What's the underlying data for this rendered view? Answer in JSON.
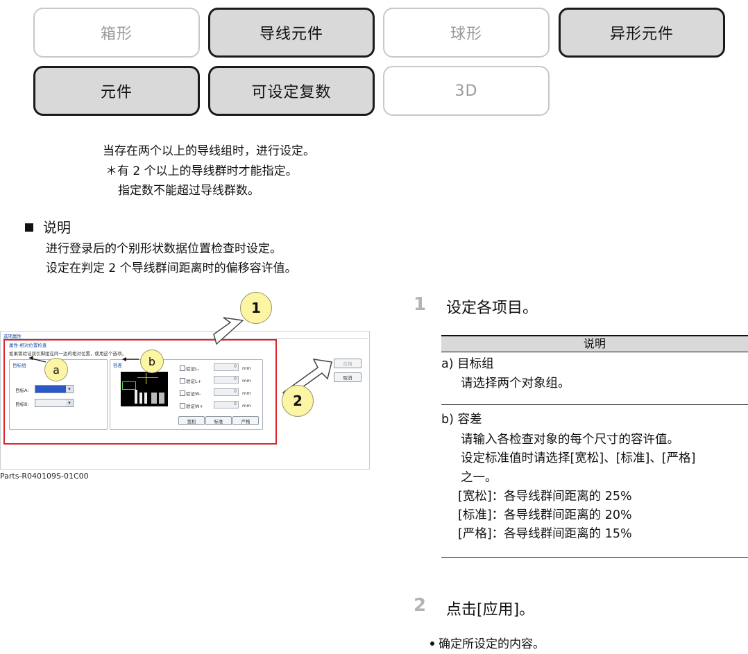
{
  "categories": [
    {
      "label": "箱形",
      "state": "off"
    },
    {
      "label": "导线元件",
      "state": "on"
    },
    {
      "label": "球形",
      "state": "off"
    },
    {
      "label": "异形元件",
      "state": "on"
    },
    {
      "label": "元件",
      "state": "on"
    },
    {
      "label": "可设定复数",
      "state": "on"
    },
    {
      "label": "3D",
      "state": "off"
    }
  ],
  "notes": {
    "line1": "当存在两个以上的导线组时，进行设定。",
    "line2": "＊有 2 个以上的导线群时才能指定。",
    "line3": "指定数不能超过导线群数。"
  },
  "explanation": {
    "title": "说明",
    "line1": "进行登录后的个别形状数据位置检查时设定。",
    "line2": "设定在判定 2 个导线群间距离时的偏移容许值。"
  },
  "screenshot": {
    "window_title": "选项属性",
    "group_title": "属性-相对位置检查",
    "hint": "如果需验证双引脚组在同一边的相对位置，使用这个选项。",
    "target_group_label": "目标组",
    "target_a_label": "目标A:",
    "target_b_label": "目标B:",
    "tolerance_label": "容差",
    "checks": [
      {
        "label": "验证L-",
        "value": "0",
        "unit": "mm"
      },
      {
        "label": "验证L+",
        "value": "0",
        "unit": "mm"
      },
      {
        "label": "验证W-",
        "value": "0",
        "unit": "mm"
      },
      {
        "label": "验证W+",
        "value": "0",
        "unit": "mm"
      }
    ],
    "preset_buttons": [
      "宽松",
      "标准",
      "严格"
    ],
    "apply_label": "应用",
    "cancel_label": "取消",
    "caption": "Parts-R040109S-01C00"
  },
  "callouts": {
    "c1": "1",
    "c2": "2",
    "ca": "a",
    "cb": "b"
  },
  "steps": [
    {
      "num": "1",
      "text": "设定各项目。"
    },
    {
      "num": "2",
      "text": "点击[应用]。"
    }
  ],
  "desc_table": {
    "header": "说明",
    "a_title": "a) 目标组",
    "a_body": "请选择两个对象组。",
    "b_title": "b) 容差",
    "b_lines": [
      "请输入各检查对象的每个尺寸的容许值。",
      "设定标准值时请选择[宽松]、[标准]、[严格]",
      "之一。",
      "[宽松]：各导线群间距离的 25%",
      "[标准]：各导线群间距离的 20%",
      "[严格]：各导线群间距离的 15%"
    ]
  },
  "step2_bullet": "确定所设定的内容。",
  "colors": {
    "highlight": "#d9262a",
    "callout": "#fbf5a4",
    "on_button": "#d9d9d9"
  }
}
